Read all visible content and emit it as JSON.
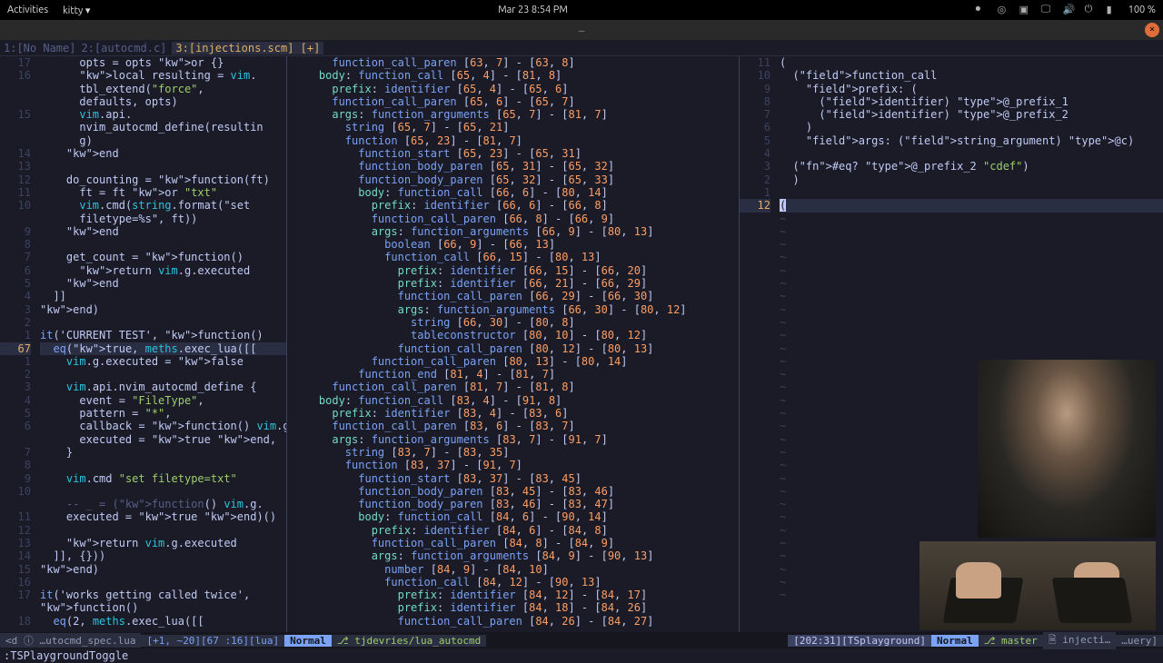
{
  "topbar": {
    "activities": "Activities",
    "app": "kitty ▾",
    "datetime": "Mar 23  8:54 PM",
    "battery": "100 %"
  },
  "titlebar": {
    "handle": "—"
  },
  "tabs": [
    {
      "label": "1:[No Name]",
      "active": false
    },
    {
      "label": "2:[autocmd.c]",
      "active": false
    },
    {
      "label": "3:[injections.scm] [+]",
      "active": true
    }
  ],
  "left_pane": {
    "gutter": [
      "17",
      "16",
      "",
      "",
      "15",
      "",
      "",
      "14",
      "13",
      "12",
      "11",
      "10",
      "",
      "9",
      "8",
      "7",
      "6",
      "5",
      "4",
      "3",
      "2",
      "1",
      "67",
      "1",
      "2",
      "3",
      "4",
      "5",
      "6",
      "",
      "7",
      "8",
      "9",
      "10",
      "",
      "11",
      "12",
      "13",
      "14",
      "15",
      "16",
      "17",
      "",
      "18"
    ],
    "lines": [
      {
        "t": "      opts = opts or {}"
      },
      {
        "t": "      local resulting = vim."
      },
      {
        "t": "      tbl_extend(\"force\","
      },
      {
        "t": "      defaults, opts)"
      },
      {
        "t": "      vim.api."
      },
      {
        "t": "      nvim_autocmd_define(resultin"
      },
      {
        "t": "      g)"
      },
      {
        "t": "    end"
      },
      {
        "t": ""
      },
      {
        "t": "    do_counting = function(ft)"
      },
      {
        "t": "      ft = ft or \"txt\""
      },
      {
        "t": "      vim.cmd(string.format(\"set"
      },
      {
        "t": "      filetype=%s\", ft))"
      },
      {
        "t": "    end"
      },
      {
        "t": ""
      },
      {
        "t": "    get_count = function()"
      },
      {
        "t": "      return vim.g.executed"
      },
      {
        "t": "    end"
      },
      {
        "t": "  ]]"
      },
      {
        "t": "end)"
      },
      {
        "t": ""
      },
      {
        "t": "it('CURRENT TEST', function()"
      },
      {
        "t": "  eq(true, meths.exec_lua([[",
        "cur": true
      },
      {
        "t": "    vim.g.executed = false"
      },
      {
        "t": ""
      },
      {
        "t": "    vim.api.nvim_autocmd_define {"
      },
      {
        "t": "      event = \"FileType\","
      },
      {
        "t": "      pattern = \"*\","
      },
      {
        "t": "      callback = function() vim.g."
      },
      {
        "t": "      executed = true end,"
      },
      {
        "t": "    }"
      },
      {
        "t": ""
      },
      {
        "t": "    vim.cmd \"set filetype=txt\""
      },
      {
        "t": ""
      },
      {
        "t": "    -- _ = (function() vim.g."
      },
      {
        "t": "    executed = true end)()"
      },
      {
        "t": ""
      },
      {
        "t": "    return vim.g.executed"
      },
      {
        "t": "  ]], {}))"
      },
      {
        "t": "end)"
      },
      {
        "t": ""
      },
      {
        "t": "it('works getting called twice',"
      },
      {
        "t": "function()"
      },
      {
        "t": "  eq(2, meths.exec_lua([["
      }
    ]
  },
  "mid_pane": {
    "lines": [
      "      function_call_paren [63, 7] - [63, 8]",
      "    body: function_call [65, 4] - [81, 8]",
      "      prefix: identifier [65, 4] - [65, 6]",
      "      function_call_paren [65, 6] - [65, 7]",
      "      args: function_arguments [65, 7] - [81, 7]",
      "        string [65, 7] - [65, 21]",
      "        function [65, 23] - [81, 7]",
      "          function_start [65, 23] - [65, 31]",
      "          function_body_paren [65, 31] - [65, 32]",
      "          function_body_paren [65, 32] - [65, 33]",
      "          body: function_call [66, 6] - [80, 14]",
      "            prefix: identifier [66, 6] - [66, 8]",
      "            function_call_paren [66, 8] - [66, 9]",
      "            args: function_arguments [66, 9] - [80, 13]",
      "              boolean [66, 9] - [66, 13]",
      "              function_call [66, 15] - [80, 13]",
      "                prefix: identifier [66, 15] - [66, 20]",
      "                prefix: identifier [66, 21] - [66, 29]",
      "                function_call_paren [66, 29] - [66, 30]",
      "                args: function_arguments [66, 30] - [80, 12]",
      "                  string [66, 30] - [80, 8]",
      "                  tableconstructor [80, 10] - [80, 12]",
      "                function_call_paren [80, 12] - [80, 13]",
      "            function_call_paren [80, 13] - [80, 14]",
      "          function_end [81, 4] - [81, 7]",
      "      function_call_paren [81, 7] - [81, 8]",
      "    body: function_call [83, 4] - [91, 8]",
      "      prefix: identifier [83, 4] - [83, 6]",
      "      function_call_paren [83, 6] - [83, 7]",
      "      args: function_arguments [83, 7] - [91, 7]",
      "        string [83, 7] - [83, 35]",
      "        function [83, 37] - [91, 7]",
      "          function_start [83, 37] - [83, 45]",
      "          function_body_paren [83, 45] - [83, 46]",
      "          function_body_paren [83, 46] - [83, 47]",
      "          body: function_call [84, 6] - [90, 14]",
      "            prefix: identifier [84, 6] - [84, 8]",
      "            function_call_paren [84, 8] - [84, 9]",
      "            args: function_arguments [84, 9] - [90, 13]",
      "              number [84, 9] - [84, 10]",
      "              function_call [84, 12] - [90, 13]",
      "                prefix: identifier [84, 12] - [84, 17]",
      "                prefix: identifier [84, 18] - [84, 26]",
      "                function_call_paren [84, 26] - [84, 27]"
    ]
  },
  "right_pane": {
    "gutter": [
      "11",
      "10",
      "9",
      "8",
      "7",
      "6",
      "5",
      "4",
      "3",
      "2",
      "1",
      "12"
    ],
    "lines": [
      "(",
      "  (function_call",
      "    prefix: (",
      "      (identifier) @_prefix_1",
      "      (identifier) @_prefix_2",
      "    )",
      "    args: (string_argument) @c)",
      "",
      "  (#eq? @_prefix_2 \"cdef\")",
      "  )",
      "",
      "("
    ],
    "cursor_line": 11
  },
  "status": {
    "left": {
      "prefix": "<d ⓘ …utocmd_spec.lua",
      "diag": "[+1, ~20][67 :16][lua]",
      "mode": "Normal",
      "branch": "⎇ tjdevries/lua_autocmd",
      "pos": "[202:31][TSplayground]"
    },
    "right": {
      "mode": "Normal",
      "branch": "⎇ master",
      "file": "🗎 injecti…",
      "end": "…uery]"
    }
  },
  "cmdline": ":TSPlaygroundToggle"
}
